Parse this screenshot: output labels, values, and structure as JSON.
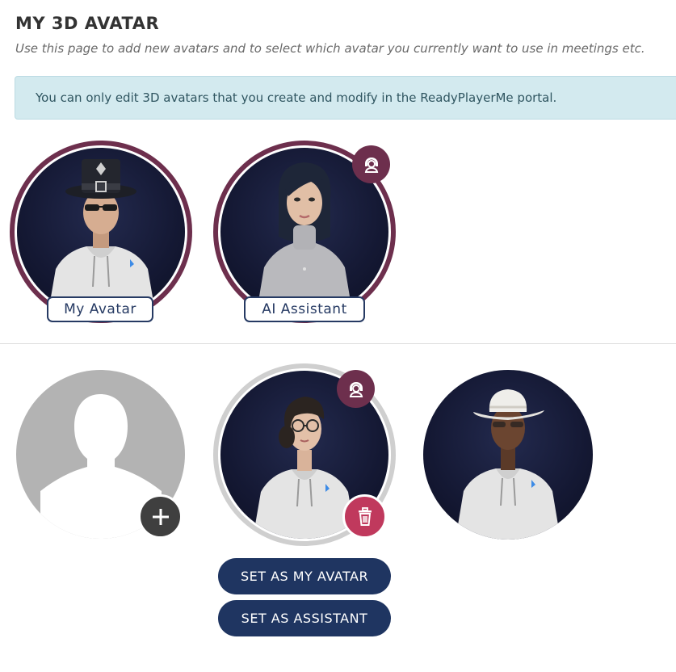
{
  "page": {
    "title": "MY 3D AVATAR",
    "subtitle": "Use this page to add new avatars and to select which avatar you currently want to use in meetings etc.",
    "info": "You can only edit 3D avatars that you create and modify in the ReadyPlayerMe portal."
  },
  "active_avatars": [
    {
      "label": "My Avatar",
      "icon": "avatar-portrait"
    },
    {
      "label": "AI Assistant",
      "icon": "avatar-portrait",
      "badge_icon": "assistant-icon"
    }
  ],
  "library": {
    "add_icon": "plus-icon",
    "items": [
      {
        "icon": "avatar-portrait",
        "badge_icon": "assistant-icon",
        "delete_icon": "trash-icon",
        "selected": true
      },
      {
        "icon": "avatar-portrait",
        "selected": false
      }
    ]
  },
  "actions": {
    "set_my_avatar": "SET AS MY AVATAR",
    "set_assistant": "SET AS ASSISTANT"
  },
  "colors": {
    "active_ring": "#6d2f4d",
    "selected_ring": "#cfcfcf",
    "button_navy": "#1f3561",
    "delete_red": "#c0395d",
    "info_bg": "#d3eaef"
  }
}
